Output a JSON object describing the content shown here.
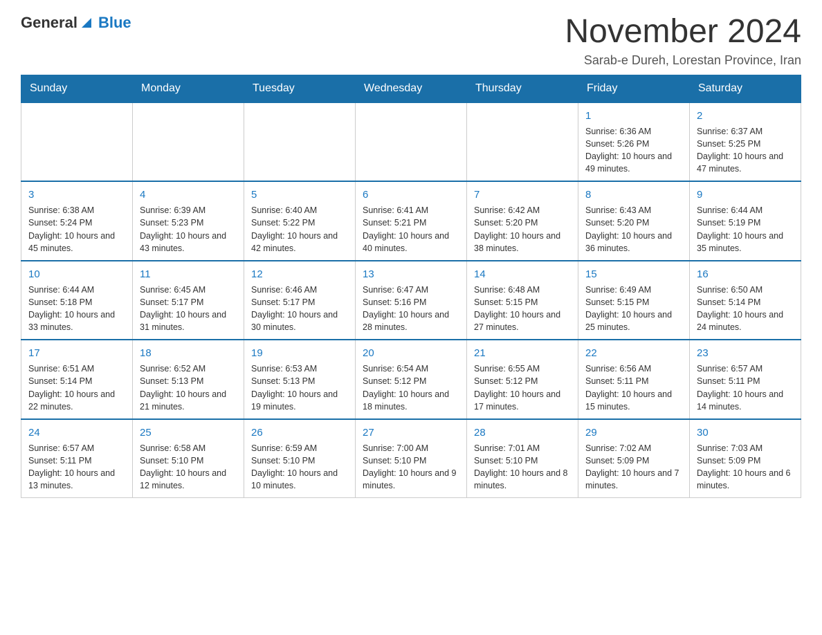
{
  "logo": {
    "text_general": "General",
    "text_blue": "Blue"
  },
  "header": {
    "month_title": "November 2024",
    "subtitle": "Sarab-e Dureh, Lorestan Province, Iran"
  },
  "days_of_week": [
    "Sunday",
    "Monday",
    "Tuesday",
    "Wednesday",
    "Thursday",
    "Friday",
    "Saturday"
  ],
  "weeks": [
    [
      {
        "day": "",
        "info": ""
      },
      {
        "day": "",
        "info": ""
      },
      {
        "day": "",
        "info": ""
      },
      {
        "day": "",
        "info": ""
      },
      {
        "day": "",
        "info": ""
      },
      {
        "day": "1",
        "info": "Sunrise: 6:36 AM\nSunset: 5:26 PM\nDaylight: 10 hours and 49 minutes."
      },
      {
        "day": "2",
        "info": "Sunrise: 6:37 AM\nSunset: 5:25 PM\nDaylight: 10 hours and 47 minutes."
      }
    ],
    [
      {
        "day": "3",
        "info": "Sunrise: 6:38 AM\nSunset: 5:24 PM\nDaylight: 10 hours and 45 minutes."
      },
      {
        "day": "4",
        "info": "Sunrise: 6:39 AM\nSunset: 5:23 PM\nDaylight: 10 hours and 43 minutes."
      },
      {
        "day": "5",
        "info": "Sunrise: 6:40 AM\nSunset: 5:22 PM\nDaylight: 10 hours and 42 minutes."
      },
      {
        "day": "6",
        "info": "Sunrise: 6:41 AM\nSunset: 5:21 PM\nDaylight: 10 hours and 40 minutes."
      },
      {
        "day": "7",
        "info": "Sunrise: 6:42 AM\nSunset: 5:20 PM\nDaylight: 10 hours and 38 minutes."
      },
      {
        "day": "8",
        "info": "Sunrise: 6:43 AM\nSunset: 5:20 PM\nDaylight: 10 hours and 36 minutes."
      },
      {
        "day": "9",
        "info": "Sunrise: 6:44 AM\nSunset: 5:19 PM\nDaylight: 10 hours and 35 minutes."
      }
    ],
    [
      {
        "day": "10",
        "info": "Sunrise: 6:44 AM\nSunset: 5:18 PM\nDaylight: 10 hours and 33 minutes."
      },
      {
        "day": "11",
        "info": "Sunrise: 6:45 AM\nSunset: 5:17 PM\nDaylight: 10 hours and 31 minutes."
      },
      {
        "day": "12",
        "info": "Sunrise: 6:46 AM\nSunset: 5:17 PM\nDaylight: 10 hours and 30 minutes."
      },
      {
        "day": "13",
        "info": "Sunrise: 6:47 AM\nSunset: 5:16 PM\nDaylight: 10 hours and 28 minutes."
      },
      {
        "day": "14",
        "info": "Sunrise: 6:48 AM\nSunset: 5:15 PM\nDaylight: 10 hours and 27 minutes."
      },
      {
        "day": "15",
        "info": "Sunrise: 6:49 AM\nSunset: 5:15 PM\nDaylight: 10 hours and 25 minutes."
      },
      {
        "day": "16",
        "info": "Sunrise: 6:50 AM\nSunset: 5:14 PM\nDaylight: 10 hours and 24 minutes."
      }
    ],
    [
      {
        "day": "17",
        "info": "Sunrise: 6:51 AM\nSunset: 5:14 PM\nDaylight: 10 hours and 22 minutes."
      },
      {
        "day": "18",
        "info": "Sunrise: 6:52 AM\nSunset: 5:13 PM\nDaylight: 10 hours and 21 minutes."
      },
      {
        "day": "19",
        "info": "Sunrise: 6:53 AM\nSunset: 5:13 PM\nDaylight: 10 hours and 19 minutes."
      },
      {
        "day": "20",
        "info": "Sunrise: 6:54 AM\nSunset: 5:12 PM\nDaylight: 10 hours and 18 minutes."
      },
      {
        "day": "21",
        "info": "Sunrise: 6:55 AM\nSunset: 5:12 PM\nDaylight: 10 hours and 17 minutes."
      },
      {
        "day": "22",
        "info": "Sunrise: 6:56 AM\nSunset: 5:11 PM\nDaylight: 10 hours and 15 minutes."
      },
      {
        "day": "23",
        "info": "Sunrise: 6:57 AM\nSunset: 5:11 PM\nDaylight: 10 hours and 14 minutes."
      }
    ],
    [
      {
        "day": "24",
        "info": "Sunrise: 6:57 AM\nSunset: 5:11 PM\nDaylight: 10 hours and 13 minutes."
      },
      {
        "day": "25",
        "info": "Sunrise: 6:58 AM\nSunset: 5:10 PM\nDaylight: 10 hours and 12 minutes."
      },
      {
        "day": "26",
        "info": "Sunrise: 6:59 AM\nSunset: 5:10 PM\nDaylight: 10 hours and 10 minutes."
      },
      {
        "day": "27",
        "info": "Sunrise: 7:00 AM\nSunset: 5:10 PM\nDaylight: 10 hours and 9 minutes."
      },
      {
        "day": "28",
        "info": "Sunrise: 7:01 AM\nSunset: 5:10 PM\nDaylight: 10 hours and 8 minutes."
      },
      {
        "day": "29",
        "info": "Sunrise: 7:02 AM\nSunset: 5:09 PM\nDaylight: 10 hours and 7 minutes."
      },
      {
        "day": "30",
        "info": "Sunrise: 7:03 AM\nSunset: 5:09 PM\nDaylight: 10 hours and 6 minutes."
      }
    ]
  ]
}
